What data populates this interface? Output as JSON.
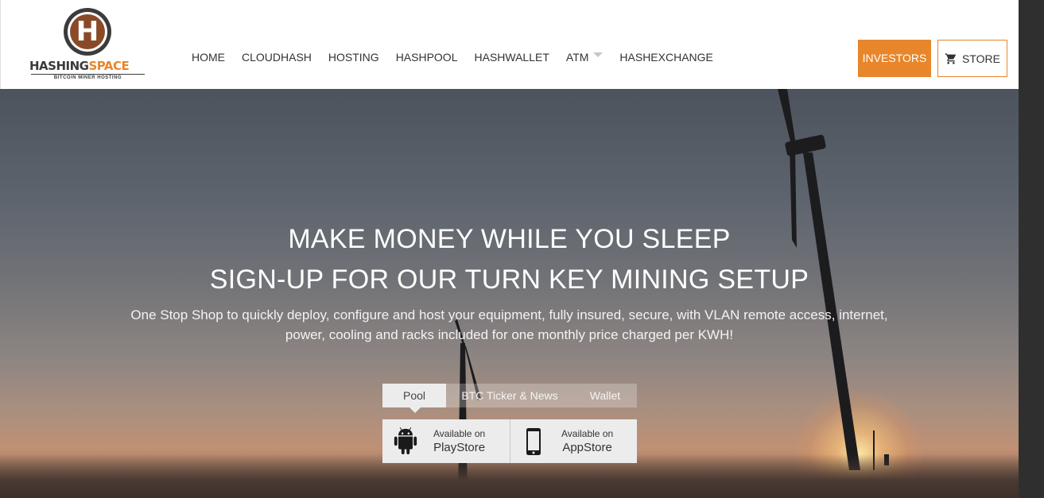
{
  "brand": {
    "name_part1": "HASHING",
    "name_part2": "SPACE",
    "tagline": "BITCOIN MINER HOSTING",
    "logo_letter": "H",
    "primary_color": "#e8862b",
    "logo_brown": "#8a4a28"
  },
  "nav": {
    "items": [
      {
        "label": "HOME"
      },
      {
        "label": "CLOUDHASH"
      },
      {
        "label": "HOSTING"
      },
      {
        "label": "HASHPOOL"
      },
      {
        "label": "HASHWALLET"
      },
      {
        "label": "ATM",
        "has_dropdown": true
      },
      {
        "label": "HASHEXCHANGE"
      }
    ],
    "investors_label": "INVESTORS",
    "store_label": "STORE",
    "store_icon": "cart-icon"
  },
  "hero": {
    "title_line1": "MAKE MONEY WHILE YOU SLEEP",
    "title_line2": "SIGN-UP FOR OUR TURN KEY MINING SETUP",
    "description": "One Stop Shop to quickly deploy, configure and host your equipment, fully insured, secure, with VLAN remote access, internet, power, cooling and racks included for one monthly price charged per KWH!",
    "tabs": [
      {
        "label": "Pool",
        "active": true
      },
      {
        "label": "BTC Ticker & News",
        "active": false
      },
      {
        "label": "Wallet",
        "active": false
      }
    ],
    "apps": [
      {
        "small": "Available on",
        "big": "PlayStore",
        "icon": "android-icon"
      },
      {
        "small": "Available on",
        "big": "AppStore",
        "icon": "smartphone-icon"
      }
    ]
  }
}
